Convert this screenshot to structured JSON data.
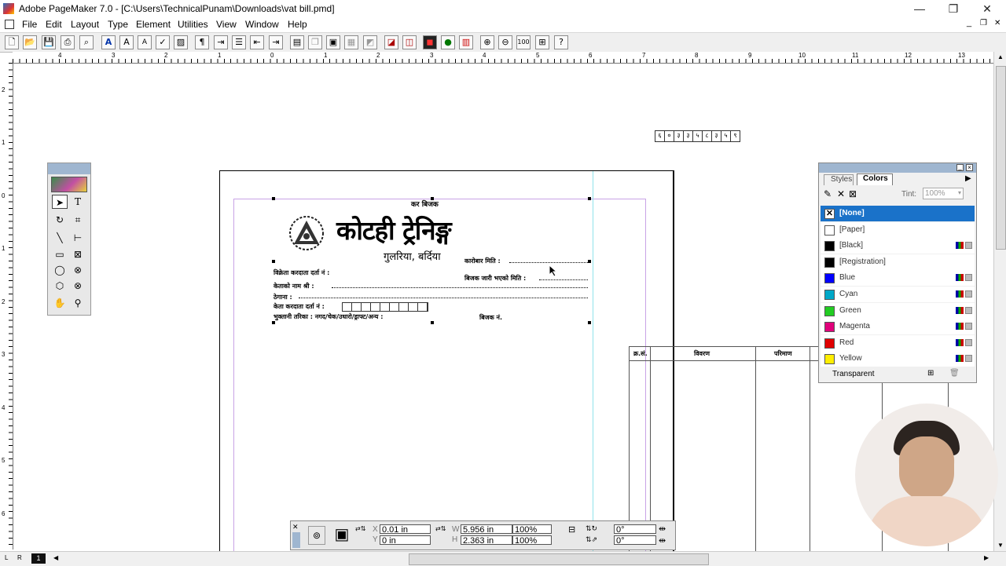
{
  "window": {
    "title": "Adobe PageMaker 7.0 - [C:\\Users\\TechnicalPunam\\Downloads\\vat bill.pmd]",
    "minimize": "—",
    "restore": "❐",
    "close": "✕",
    "doc_min": "_",
    "doc_restore": "❐",
    "doc_close": "✕"
  },
  "menu": [
    "File",
    "Edit",
    "Layout",
    "Type",
    "Element",
    "Utilities",
    "View",
    "Window",
    "Help"
  ],
  "ruler": {
    "h_labels": [
      "4",
      "3",
      "2",
      "1",
      "0",
      "1",
      "2",
      "3",
      "4",
      "5",
      "6",
      "7",
      "8",
      "9",
      "10",
      "11",
      "12",
      "13"
    ],
    "v_labels": [
      "2",
      "1",
      "0",
      "1",
      "2",
      "3",
      "4",
      "5",
      "6"
    ]
  },
  "document": {
    "tax_heading": "कर बिजक",
    "company_name": "कोटही ट्रेनिङ्ग",
    "address": "गुलरिया, बर्दिया",
    "logo_text": "Kotahi Training",
    "pan_boxes": [
      "६",
      "०",
      "३",
      "३",
      "५",
      "८",
      "३",
      "५",
      "९"
    ],
    "transaction_date": "कारोबार मिति :",
    "vat_reg": "विक्रेता करदाता दर्ता नं :",
    "invoice_issue_date": "बिजक जारी भएको मिति :",
    "buyer_name": "केताको नाम श्री :",
    "address_label": "ठेगाना :",
    "buyer_pan": "केता करदाता दर्ता नं :",
    "payment_method": "भुक्तानी तरिका : नगद/चेक/उधारो/ड्राफ्ट/अन्य :",
    "invoice_no": "बिजक नं."
  },
  "table": {
    "headers": [
      "क्र.सं.",
      "विवरण",
      "परिमाण"
    ]
  },
  "toolbox": {
    "tools": [
      "pointer",
      "text",
      "rotate",
      "crop",
      "line",
      "constrained-line",
      "rectangle",
      "rect-frame",
      "ellipse",
      "ellipse-frame",
      "polygon",
      "polygon-frame",
      "hand",
      "zoom"
    ],
    "text_tool": "T"
  },
  "colors_palette": {
    "tabs": [
      "Styles",
      "Colors"
    ],
    "tint_label": "Tint:",
    "tint_value": "100%",
    "items": [
      {
        "name": "[None]",
        "color": "#ffffff",
        "selected": true
      },
      {
        "name": "[Paper]",
        "color": "#ffffff"
      },
      {
        "name": "[Black]",
        "color": "#000000"
      },
      {
        "name": "[Registration]",
        "color": "#000000"
      },
      {
        "name": "Blue",
        "color": "#0000ff"
      },
      {
        "name": "Cyan",
        "color": "#00a8c8"
      },
      {
        "name": "Green",
        "color": "#22cc22"
      },
      {
        "name": "Magenta",
        "color": "#e0007a"
      },
      {
        "name": "Red",
        "color": "#e00000"
      },
      {
        "name": "Yellow",
        "color": "#ffee00"
      }
    ],
    "transparent_label": "Transparent"
  },
  "control_palette": {
    "x_label": "X",
    "y_label": "Y",
    "w_label": "W",
    "h_label": "H",
    "x": "0.01 in",
    "y": "0 in",
    "w": "5.956 in",
    "h": "2.363 in",
    "scale_w": "100%",
    "scale_h": "100%",
    "rotation": "0°",
    "skew": "0°"
  },
  "page_nav": {
    "left_page": "L",
    "right_page": "R",
    "current_page": "1"
  }
}
